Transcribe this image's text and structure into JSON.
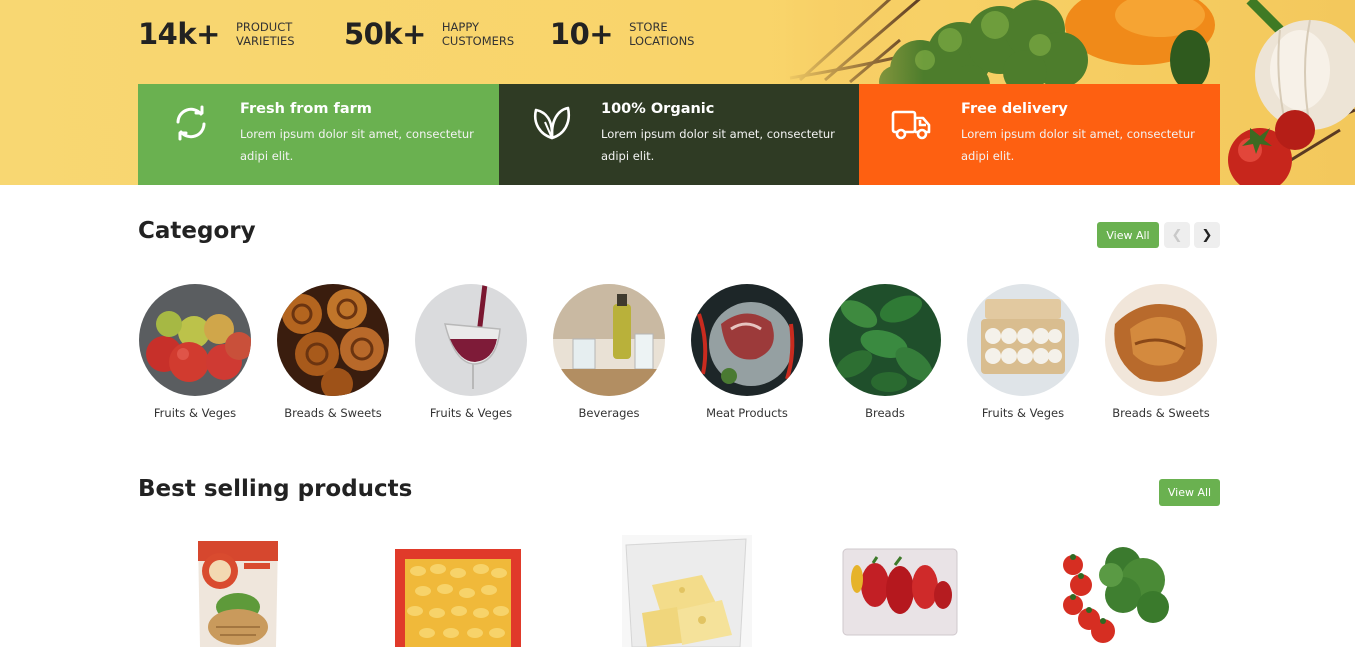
{
  "stats": [
    {
      "number": "14k+",
      "label_line1": "PRODUCT",
      "label_line2": "VARIETIES"
    },
    {
      "number": "50k+",
      "label_line1": "HAPPY",
      "label_line2": "CUSTOMERS"
    },
    {
      "number": "10+",
      "label_line1": "STORE",
      "label_line2": "LOCATIONS"
    }
  ],
  "features": [
    {
      "title": "Fresh from farm",
      "text": "Lorem ipsum dolor sit amet, consectetur adipi elit.",
      "icon": "refresh-icon",
      "color": "#6ab150"
    },
    {
      "title": "100% Organic",
      "text": "Lorem ipsum dolor sit amet, consectetur adipi elit.",
      "icon": "leaf-icon",
      "color": "#2f3b24"
    },
    {
      "title": "Free delivery",
      "text": "Lorem ipsum dolor sit amet, consectetur adipi elit.",
      "icon": "truck-icon",
      "color": "#fe6011"
    }
  ],
  "category": {
    "title": "Category",
    "view_all": "View All",
    "prev": "❮",
    "next": "❯",
    "items": [
      {
        "name": "Fruits & Veges"
      },
      {
        "name": "Breads & Sweets"
      },
      {
        "name": "Fruits & Veges"
      },
      {
        "name": "Beverages"
      },
      {
        "name": "Meat Products"
      },
      {
        "name": "Breads"
      },
      {
        "name": "Fruits & Veges"
      },
      {
        "name": "Breads & Sweets"
      }
    ]
  },
  "best_selling": {
    "title": "Best selling products",
    "view_all": "View All"
  },
  "colors": {
    "accent_green": "#6ab150",
    "dark_green": "#2f3b24",
    "orange": "#fe6011",
    "hero_yellow": "#f8d772"
  }
}
